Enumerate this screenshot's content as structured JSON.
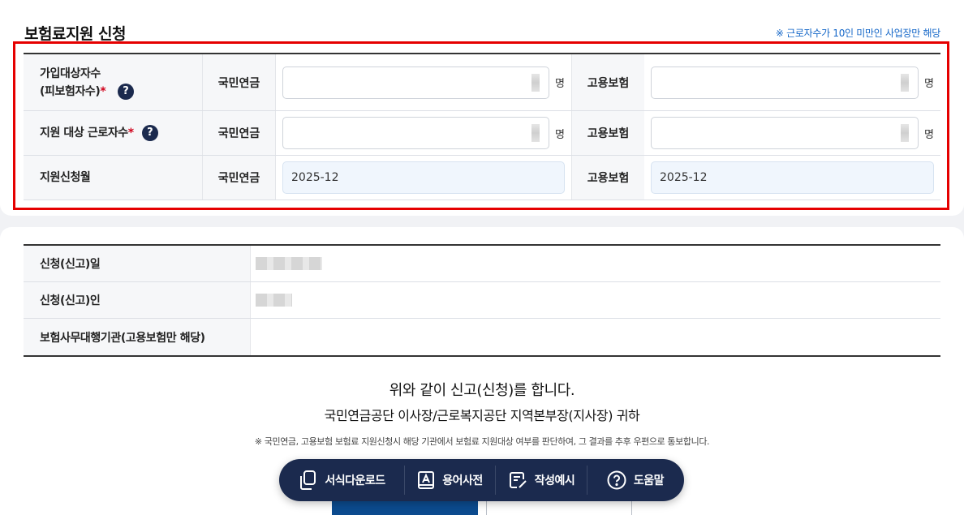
{
  "section": {
    "title": "보험료지원 신청",
    "note": "※ 근로자수가 10인 미만인 사업장만 해당"
  },
  "form": {
    "rows": [
      {
        "label_line1": "가입대상자수",
        "label_line2": "(피보험자수)",
        "required": "*",
        "help": "?",
        "left_sub": "국민연금",
        "left_unit": "명",
        "right_sub": "고용보험",
        "right_unit": "명"
      },
      {
        "label_line1": "지원 대상 근로자수",
        "required": "*",
        "help": "?",
        "left_sub": "국민연금",
        "left_unit": "명",
        "right_sub": "고용보험",
        "right_unit": "명"
      },
      {
        "label_line1": "지원신청월",
        "left_sub": "국민연금",
        "left_value": "2025-12",
        "right_sub": "고용보험",
        "right_value": "2025-12"
      }
    ]
  },
  "info": {
    "rows": [
      {
        "label": "신청(신고)일"
      },
      {
        "label": "신청(신고)인"
      },
      {
        "label": "보험사무대행기관(고용보험만 해당)"
      }
    ]
  },
  "declaration": {
    "line1": "위와 같이 신고(신청)를 합니다.",
    "line2": "국민연금공단 이사장/근로복지공단 지역본부장(지사장) 귀하",
    "note": "※ 국민연금, 고용보험 보험료 지원신청시 해당 기관에서 보험료 지원대상 여부를 판단하여, 그 결과를 추후 우편으로 통보합니다."
  },
  "toolbar": {
    "items": [
      {
        "label": "서식다운로드",
        "icon": "document-download-icon"
      },
      {
        "label": "용어사전",
        "icon": "dictionary-icon"
      },
      {
        "label": "작성예시",
        "icon": "edit-note-icon"
      },
      {
        "label": "도움말",
        "icon": "help-circle-icon"
      }
    ]
  },
  "colors": {
    "required": "#d0021b",
    "note": "#1567c8",
    "toolbar_bg": "#1b2a4e",
    "highlight_box": "#e50000",
    "primary_button": "#0c4b8e"
  }
}
